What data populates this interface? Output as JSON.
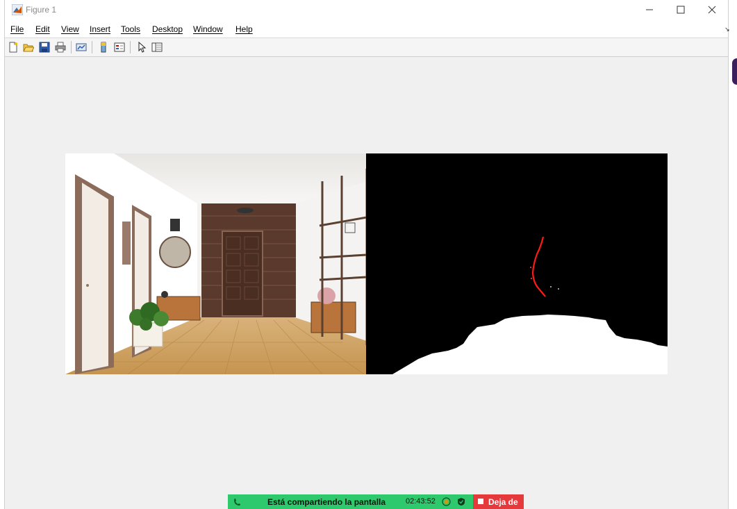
{
  "window": {
    "title": "Figure 1"
  },
  "menu": [
    {
      "label": "File"
    },
    {
      "label": "Edit"
    },
    {
      "label": "View"
    },
    {
      "label": "Insert"
    },
    {
      "label": "Tools"
    },
    {
      "label": "Desktop"
    },
    {
      "label": "Window"
    },
    {
      "label": "Help"
    }
  ],
  "toolbar": {
    "icons": [
      "new-figure-icon",
      "open-file-icon",
      "save-icon",
      "print-icon",
      "link-plot-icon",
      "insert-colorbar-icon",
      "insert-legend-icon",
      "edit-plot-icon",
      "property-inspector-icon"
    ]
  },
  "figure": {
    "left_image": "hallway-photo",
    "right_image": "binary-mask",
    "colors": {
      "mask_bg": "#000000",
      "mask_fg": "#ffffff",
      "contour": "#ff0000"
    }
  },
  "share": {
    "message": "Está compartiendo la pantalla",
    "time": "02:43:52",
    "stop_label": "Deja de",
    "colors": {
      "bar": "#2ec96c",
      "stop": "#e5393b"
    }
  }
}
